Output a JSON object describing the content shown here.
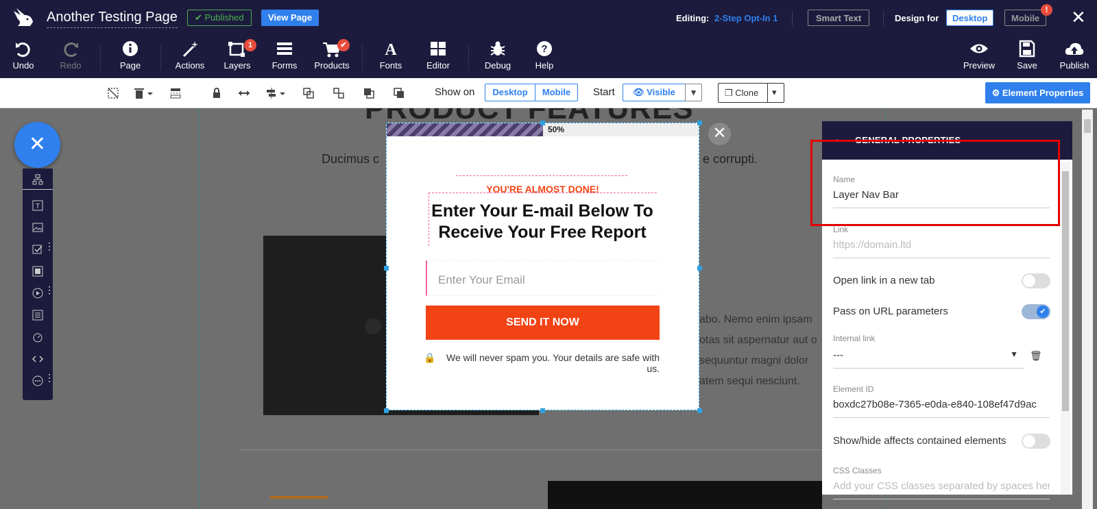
{
  "header": {
    "page_title": "Another Testing Page",
    "published_label": "Published",
    "view_page_label": "View Page",
    "editing_label": "Editing:",
    "editing_value": "2-Step Opt-In 1",
    "smart_text_label": "Smart Text",
    "design_for_label": "Design for",
    "desktop_label": "Desktop",
    "mobile_label": "Mobile",
    "mobile_badge": "!"
  },
  "toolbar": {
    "undo": "Undo",
    "redo": "Redo",
    "page": "Page",
    "actions": "Actions",
    "layers": "Layers",
    "layers_badge": "1",
    "forms": "Forms",
    "products": "Products",
    "fonts": "Fonts",
    "editor": "Editor",
    "debug": "Debug",
    "help": "Help",
    "preview": "Preview",
    "save": "Save",
    "publish": "Publish"
  },
  "subtoolbar": {
    "show_on": "Show on",
    "desktop": "Desktop",
    "mobile": "Mobile",
    "start": "Start",
    "visible": "Visible",
    "clone": "Clone",
    "element_properties": "Element Properties"
  },
  "background": {
    "title": "PRODUCT FEATURES",
    "subtitle_left": "Ducimus c",
    "subtitle_right": "e corrupti.",
    "para_lines": [
      "abo. Nemo enim ipsam",
      "otas sit aspernatur aut o",
      "sequuntur magni dolor",
      "atem sequi nesciunt."
    ]
  },
  "popup": {
    "progress_label": "50%",
    "progress_percent": 50,
    "eyebrow": "YOU'RE ALMOST DONE!",
    "headline": "Enter Your E-mail Below To Receive Your Free Report",
    "email_placeholder": "Enter Your Email",
    "button_label": "SEND IT NOW",
    "privacy_text": "We will never spam you. Your details are safe with us."
  },
  "panel": {
    "title": "GENERAL PROPERTIES",
    "name_label": "Name",
    "name_value": "Layer Nav Bar",
    "link_label": "Link",
    "link_placeholder": "https://domain.ltd",
    "open_new_tab_label": "Open link in a new tab",
    "open_new_tab_on": false,
    "pass_url_label": "Pass on URL parameters",
    "pass_url_on": true,
    "internal_link_label": "Internal link",
    "internal_link_value": "---",
    "element_id_label": "Element ID",
    "element_id_value": "boxdc27b08e-7365-e0da-e840-108ef47d9ac",
    "show_hide_label": "Show/hide affects contained elements",
    "show_hide_on": false,
    "css_classes_label": "CSS Classes",
    "css_classes_placeholder": "Add your CSS classes separated by spaces her"
  },
  "colors": {
    "brand_navy": "#1c1b3d",
    "accent_blue": "#2f80ed",
    "cta_orange": "#f24315",
    "published_green": "#4caf50",
    "highlight_red": "#e30000"
  }
}
